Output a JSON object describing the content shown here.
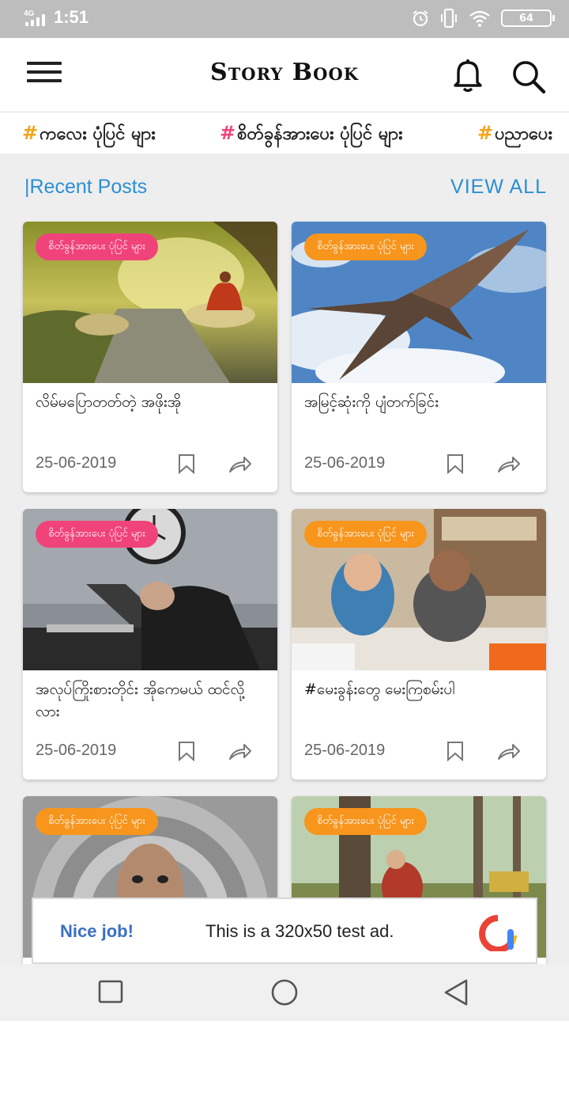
{
  "status_bar": {
    "network": "4G",
    "time": "1:51",
    "battery": "64"
  },
  "app_bar": {
    "title": "Story Book"
  },
  "tags": [
    {
      "hash": "#",
      "label": "ကလေး ပုံပြင် များ",
      "hash_color": "#f5a31a"
    },
    {
      "hash": "#",
      "label": "စိတ်ခွန်အားပေး ပုံပြင် များ",
      "hash_color": "#f0437a"
    },
    {
      "hash": "#",
      "label": "ပညာပေး",
      "hash_color": "#f5a31a"
    }
  ],
  "section": {
    "title": "|Recent Posts",
    "view_all": "VIEW ALL"
  },
  "posts": [
    {
      "badge": "စိတ်ခွန်အားပေး ပုံပြင် များ",
      "badge_color": "#f0437a",
      "title": "လိမ်မပြောတတ်တဲ့ အဖိုးအို",
      "date": "25-06-2019"
    },
    {
      "badge": "စိတ်ခွန်အားပေး ပုံပြင် များ",
      "badge_color": "#f7951d",
      "title": "အမြင့်ဆုံးကို ပျံတက်ခြင်း",
      "date": "25-06-2019"
    },
    {
      "badge": "စိတ်ခွန်အားပေး ပုံပြင် များ",
      "badge_color": "#f0437a",
      "title": "အလုပ်ကြိုးစားတိုင်း အိုကေမယ် ထင်လို့လား",
      "date": "25-06-2019"
    },
    {
      "badge": "စိတ်ခွန်အားပေး ပုံပြင် များ",
      "badge_color": "#f7951d",
      "title": "#မေးခွန်းတွေ မေးကြစမ်းပါ",
      "date": "25-06-2019"
    },
    {
      "badge": "စိတ်ခွန်အားပေး ပုံပြင် များ",
      "badge_color": "#f7951d",
      "title": "",
      "date": ""
    },
    {
      "badge": "စိတ်ခွန်အားပေး ပုံပြင် များ",
      "badge_color": "#f7951d",
      "title": "",
      "date": ""
    }
  ],
  "ad": {
    "headline": "Nice job!",
    "message": "This is a 320x50 test ad."
  },
  "colors": {
    "accent_blue": "#2b8fd4",
    "status_bar": "#bdbdbd",
    "background": "#eeeeee"
  }
}
